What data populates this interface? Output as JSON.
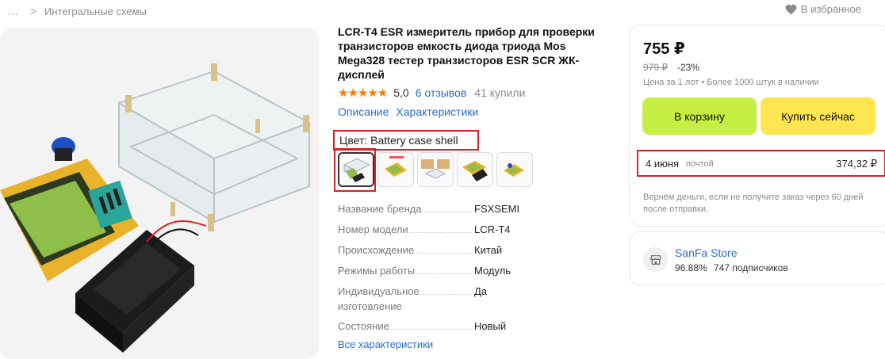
{
  "breadcrumb": {
    "dots": "...",
    "separator": ">",
    "category": "Интегральные схемы"
  },
  "favorites": {
    "label": "В избранное"
  },
  "product": {
    "title": "LCR-T4 ESR измеритель прибор для проверки транзисторов емкость диода триода Mos Mega328 тестер транзисторов ESR SCR ЖК-дисплей",
    "stars": "★★★★★",
    "rating": "5,0",
    "reviews": "6 отзывов",
    "bought": "41 купили",
    "tabs": [
      "Описание",
      "Характеристики"
    ],
    "color_label": "Цвет: Battery case shell"
  },
  "specs": [
    {
      "name": "Название бренда",
      "value": "FSXSEMI"
    },
    {
      "name": "Номер модели",
      "value": "LCR-T4"
    },
    {
      "name": "Происхождение",
      "value": "Китай"
    },
    {
      "name": "Режимы работы",
      "value": "Модуль"
    },
    {
      "name": "Индивидуальное изготовление",
      "value": "Да"
    },
    {
      "name": "Состояние",
      "value": "Новый"
    }
  ],
  "all_specs": "Все характеристики",
  "buy_box": {
    "price": "755 ₽",
    "old_price": "979 ₽",
    "discount": "-23%",
    "unit_note": "Цена за 1 лот • Более 1000 штук в наличии",
    "cart_button": "В корзину",
    "buy_button": "Купить сейчас",
    "delivery_date": "4 июня",
    "delivery_method": "почтой",
    "delivery_cost": "374,32 ₽",
    "refund_note": "Вернём деньги, если не получите заказ через 60 дней после отправки."
  },
  "seller": {
    "name": "SanFa Store",
    "rating": "96.88%",
    "subscribers": "747 подписчиков"
  },
  "colors": {
    "link": "#2b6ccb",
    "star": "#ff7a00",
    "cart_button": "#c6ef43",
    "buy_button": "#ffe54f",
    "highlight": "#d8202a"
  },
  "icons": [
    "chevron-right-icon",
    "heart-icon",
    "store-icon"
  ]
}
